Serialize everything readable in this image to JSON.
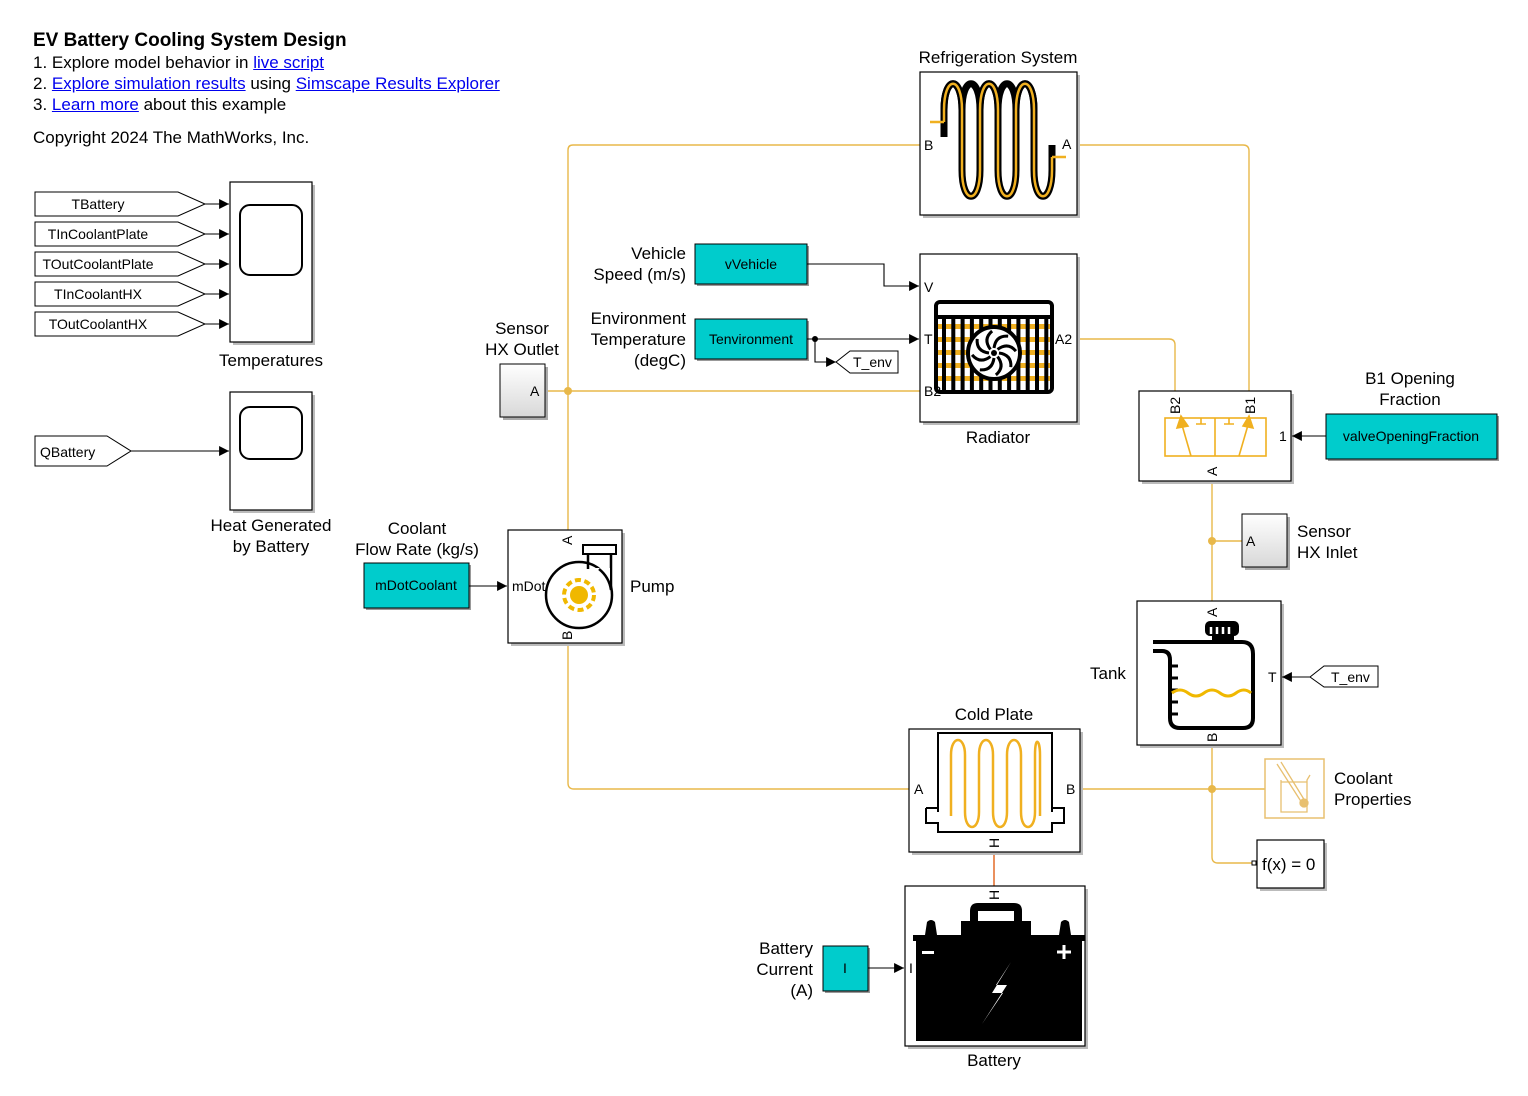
{
  "header": {
    "title": "EV Battery Cooling System Design",
    "line1_prefix": "1. Explore model behavior in ",
    "line1_link": "live script",
    "line2_prefix": "2. ",
    "line2_link1": "Explore simulation results",
    "line2_mid": " using ",
    "line2_link2": "Simscape Results Explorer",
    "line3_prefix": "3. ",
    "line3_link": "Learn more",
    "line3_suffix": " about this example",
    "copyright": "Copyright 2024 The MathWorks, Inc."
  },
  "scopes": {
    "temperatures": {
      "label": "Temperatures",
      "inputs": [
        "TBattery",
        "TInCoolantPlate",
        "TOutCoolantPlate",
        "TInCoolantHX",
        "TOutCoolantHX"
      ]
    },
    "heat": {
      "label_line1": "Heat Generated",
      "label_line2": "by Battery",
      "input": "QBattery"
    }
  },
  "blocks": {
    "refrigeration": {
      "label": "Refrigeration System",
      "port_left": "B",
      "port_right": "A"
    },
    "radiator": {
      "label": "Radiator",
      "ports": {
        "v": "V",
        "t": "T",
        "a2": "A2",
        "b2": "B2"
      }
    },
    "vehicle_speed": {
      "label_line1": "Vehicle",
      "label_line2": "Speed (m/s)",
      "value": "vVehicle"
    },
    "env_temp": {
      "label_line1": "Environment",
      "label_line2": "Temperature",
      "label_line3": "(degC)",
      "value": "Tenvironment",
      "goto": "T_env"
    },
    "sensor_outlet": {
      "label_line1": "Sensor",
      "label_line2": "HX Outlet",
      "port": "A"
    },
    "sensor_inlet": {
      "label_line1": "Sensor",
      "label_line2": "HX Inlet",
      "port": "A"
    },
    "valve": {
      "ports": {
        "b2": "B2",
        "b1": "B1",
        "a": "A",
        "in": "1"
      }
    },
    "valve_opening": {
      "label_line1": "B1 Opening",
      "label_line2": "Fraction",
      "value": "valveOpeningFraction"
    },
    "pump": {
      "label": "Pump",
      "ports": {
        "a": "A",
        "b": "B",
        "mdot": "mDot"
      }
    },
    "coolant_flow": {
      "label_line1": "Coolant",
      "label_line2": "Flow Rate (kg/s)",
      "value": "mDotCoolant"
    },
    "tank": {
      "label": "Tank",
      "ports": {
        "a": "A",
        "b": "B",
        "t": "T"
      },
      "from": "T_env"
    },
    "cold_plate": {
      "label": "Cold Plate",
      "ports": {
        "a": "A",
        "b": "B",
        "h": "H"
      }
    },
    "coolant_props": {
      "label_line1": "Coolant",
      "label_line2": "Properties"
    },
    "solver": {
      "label": "f(x) = 0"
    },
    "battery": {
      "label": "Battery",
      "ports": {
        "h": "H",
        "i": "I"
      },
      "minus": "−",
      "plus": "+"
    },
    "battery_current": {
      "label_line1": "Battery",
      "label_line2": "Current",
      "label_line3": "(A)",
      "value": "I"
    }
  },
  "colors": {
    "physical_line": "#e8b84a",
    "thermal_line": "#e0601a",
    "constant_fill": "#00cccc",
    "link": "#0000ee"
  }
}
